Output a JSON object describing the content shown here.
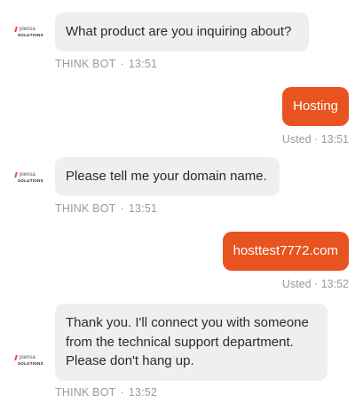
{
  "brand": {
    "logo_top": "piensa",
    "logo_bottom": "SOLUTIONS",
    "accent_color": "#e8531f"
  },
  "messages": [
    {
      "sender": "bot",
      "text": "What product are you inquiring about?",
      "name": "THINK BOT",
      "dot": "·",
      "time": "13:51"
    },
    {
      "sender": "user",
      "text": "Hosting",
      "name": "Usted",
      "dot": "·",
      "time": "13:51"
    },
    {
      "sender": "bot",
      "text": "Please tell me your domain name.",
      "name": "THINK BOT",
      "dot": "·",
      "time": "13:51"
    },
    {
      "sender": "user",
      "text": "hosttest7772.com",
      "name": "Usted",
      "dot": "·",
      "time": "13:52"
    },
    {
      "sender": "bot",
      "text": "Thank you. I'll connect you with someone from the technical support department. Please don't hang up.",
      "name": "THINK BOT",
      "dot": "·",
      "time": "13:52"
    }
  ]
}
